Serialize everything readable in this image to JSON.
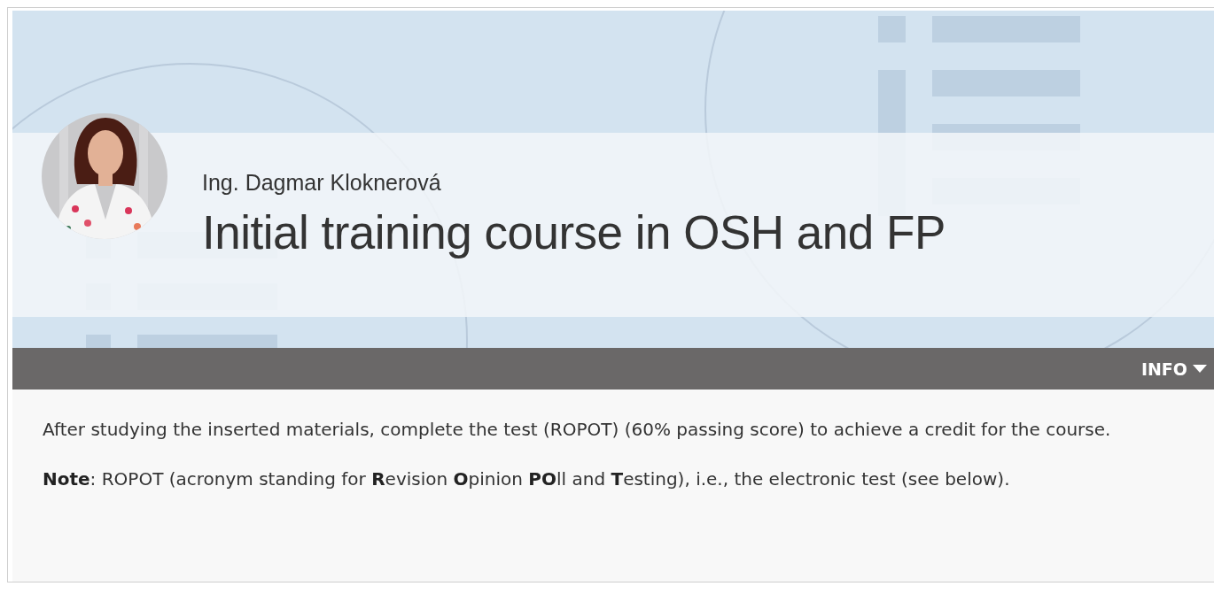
{
  "author": {
    "name": "Ing. Dagmar Kloknerová"
  },
  "course_title": "Initial training course in OSH and FP",
  "info_toggle": {
    "label": "INFO",
    "expanded": true
  },
  "paragraphs": [
    "After studying the inserted materials, complete the test (ROPOT) (60% passing score) to achieve a credit for the course.",
    "**Note**: ROPOT (acronym standing for **R**evision **O**pinion **PO**ll and **T**esting), i.e., the electronic test (see below)."
  ]
}
